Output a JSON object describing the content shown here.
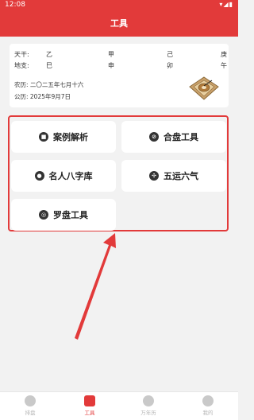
{
  "status": {
    "time": "12:08",
    "icons": "▾◢▮"
  },
  "header": {
    "title": "工具"
  },
  "info": {
    "tiangan": {
      "label": "天干:",
      "cols": [
        "乙",
        "甲",
        "己",
        "庚"
      ]
    },
    "dizhi": {
      "label": "地支:",
      "cols": [
        "巳",
        "申",
        "卯",
        "午"
      ]
    },
    "nongli": "农历: 二〇二五年七月十六",
    "gongli": "公历: 2025年9月7日"
  },
  "tools": [
    {
      "label": "案例解析",
      "icon": "stop-square-icon",
      "glyph": "■"
    },
    {
      "label": "合盘工具",
      "icon": "compass-needle-icon",
      "glyph": "⊘"
    },
    {
      "label": "名人八字库",
      "icon": "person-icon",
      "glyph": "●"
    },
    {
      "label": "五运六气",
      "icon": "triskelion-icon",
      "glyph": "✣"
    },
    {
      "label": "罗盘工具",
      "icon": "compass-icon",
      "glyph": "◎"
    }
  ],
  "tabs": [
    {
      "label": "排盘",
      "icon": "chart-icon"
    },
    {
      "label": "工具",
      "icon": "toolbox-icon",
      "active": true
    },
    {
      "label": "万年历",
      "icon": "calendar-icon"
    },
    {
      "label": "我的",
      "icon": "person-icon"
    }
  ],
  "colors": {
    "primary": "#e23a3a",
    "background": "#f2f2f2",
    "card": "#ffffff"
  }
}
